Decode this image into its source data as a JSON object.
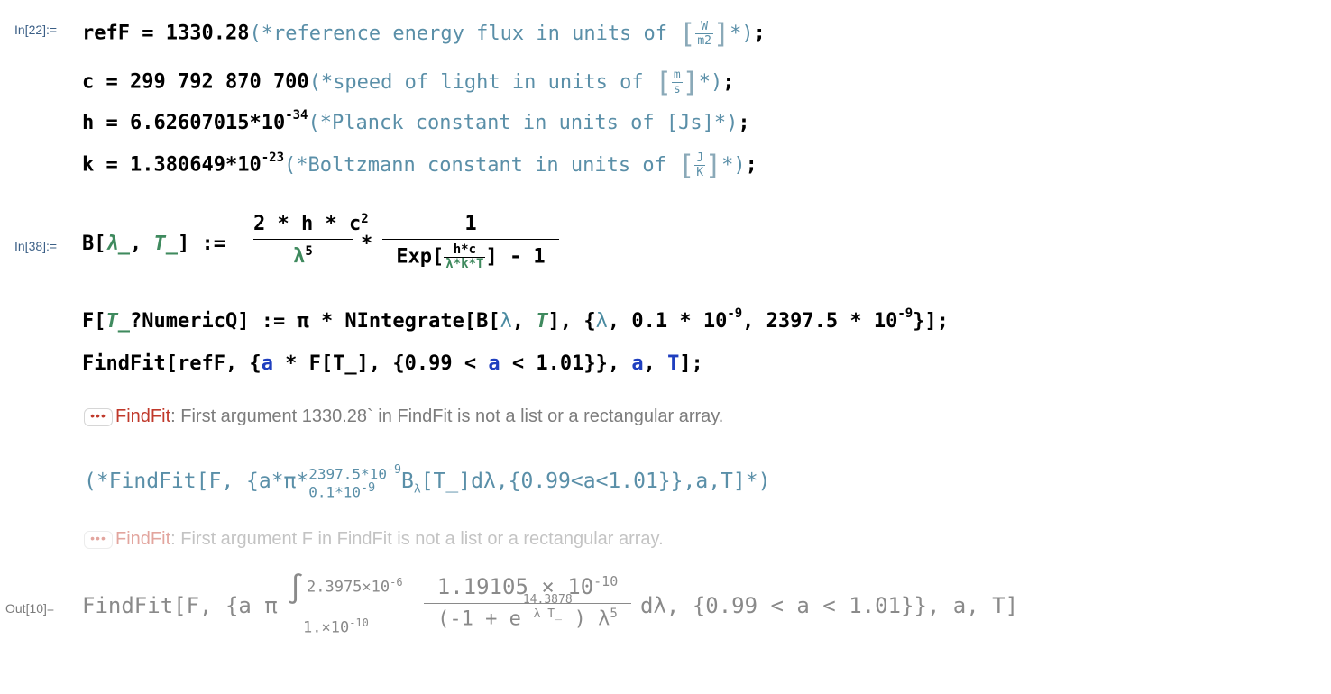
{
  "cells": {
    "in22": {
      "label": "In[22]:=",
      "lines": [
        {
          "lhs": "refF",
          "op": "=",
          "value": "1330.28",
          "comment_open": "(*",
          "comment": "reference energy flux in units of",
          "unit_num": "W",
          "unit_den": "m2",
          "comment_close": "*)",
          "end": ";"
        },
        {
          "lhs": "c",
          "op": "=",
          "value": "299 792 870 700",
          "comment_open": "(*",
          "comment": "speed of light in units of",
          "unit_num": "m",
          "unit_den": "s",
          "comment_close": "*)",
          "end": ";"
        },
        {
          "lhs": "h",
          "op": "=",
          "mantissa": "6.62607015",
          "times": "*",
          "base": "10",
          "exponent": "-34",
          "comment_open": "(*",
          "comment": "Planck constant in units of",
          "unit": "[Js]",
          "comment_close": "*)",
          "end": ";"
        },
        {
          "lhs": "k",
          "op": "=",
          "mantissa": "1.380649",
          "times": "*",
          "base": "10",
          "exponent": "-23",
          "comment_open": "(*",
          "comment": "Boltzmann constant in units of",
          "unit_num": "J",
          "unit_den": "K",
          "comment_close": "*)",
          "end": ";"
        }
      ]
    },
    "in38": {
      "label": "In[38]:=",
      "def_lhs": "B[",
      "arg1": "λ_",
      "arg2": "T_",
      "def_close": "]",
      "def_op": ":=",
      "frac1_num": "2 * h * c",
      "frac1_num_sup": "2",
      "frac1_den": "λ",
      "frac1_den_sup": "5",
      "times": "*",
      "frac2_num": "1",
      "frac2_den_pre": "Exp[",
      "frac2_den_inner_num": "h*c",
      "frac2_den_inner_den": "λ*k*T",
      "frac2_den_post": "] - 1",
      "line2": {
        "prefix": "F[",
        "arg": "T_",
        "test": "?NumericQ]",
        "op": ":=",
        "body1": "π * NIntegrate[B[",
        "lam": "λ",
        "comma": ", ",
        "T": "T",
        "body2": "], {",
        "lam2": "λ",
        "lo": ", 0.1 * 10",
        "lo_exp": "-9",
        "hi": ", 2397.5 * 10",
        "hi_exp": "-9",
        "end": "}];"
      },
      "line3": {
        "pre": "FindFit[refF, {",
        "a1": "a",
        "mid1": " * F[T_], {0.99 < ",
        "a2": "a",
        "mid2": " < 1.01}}, ",
        "a3": "a",
        "mid3": ", ",
        "T": "T",
        "end": "];"
      },
      "message1": {
        "tag": "FindFit",
        "sep": ":",
        "text": "First argument 1330.28` in FindFit is not a list or a rectangular array."
      },
      "comment_line": {
        "open": "(*FindFit[F, {a*π*",
        "int_hi": "2397.5*10",
        "int_hi_exp": "-9",
        "int_lo": "0.1*10",
        "int_lo_exp": "-9",
        "body": "B",
        "body_sub": "λ",
        "rest": "[T_]dλ,{0.99<a<1.01}},a,T]*)"
      },
      "message2": {
        "tag": "FindFit",
        "sep": ":",
        "text": "First argument F in FindFit is not a list or a rectangular array."
      }
    },
    "out10": {
      "label": "Out[10]=",
      "pre": "FindFit[F, {a π",
      "int_hi": "2.3975×10",
      "int_hi_exp": "-6",
      "int_lo": "1.×10",
      "int_lo_exp": "-10",
      "num": "1.19105 × 10",
      "num_exp": "-10",
      "den_pre": "(-1 + e",
      "den_exp_num": "14.3878",
      "den_exp_den": "λ T_",
      "den_post": ") λ",
      "den_post_exp": "5",
      "diff": "dλ,",
      "rest": "{0.99 < a < 1.01}}, a, T]"
    }
  }
}
